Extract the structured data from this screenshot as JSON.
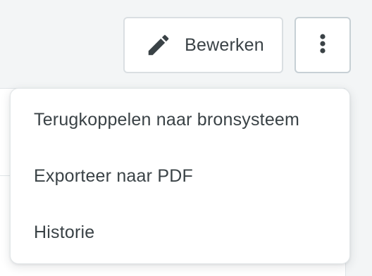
{
  "header": {
    "edit_button": {
      "label": "Bewerken",
      "icon": "pencil-icon"
    },
    "more_button": {
      "icon": "more-vertical-icon"
    }
  },
  "menu": {
    "items": [
      {
        "label": "Terugkoppelen naar bronsysteem"
      },
      {
        "label": "Exporteer naar PDF"
      },
      {
        "label": "Historie"
      }
    ]
  },
  "colors": {
    "page_background": "#f3f5f6",
    "text": "#3a4246",
    "border": "#dadfe2",
    "icon": "#3a4246"
  }
}
